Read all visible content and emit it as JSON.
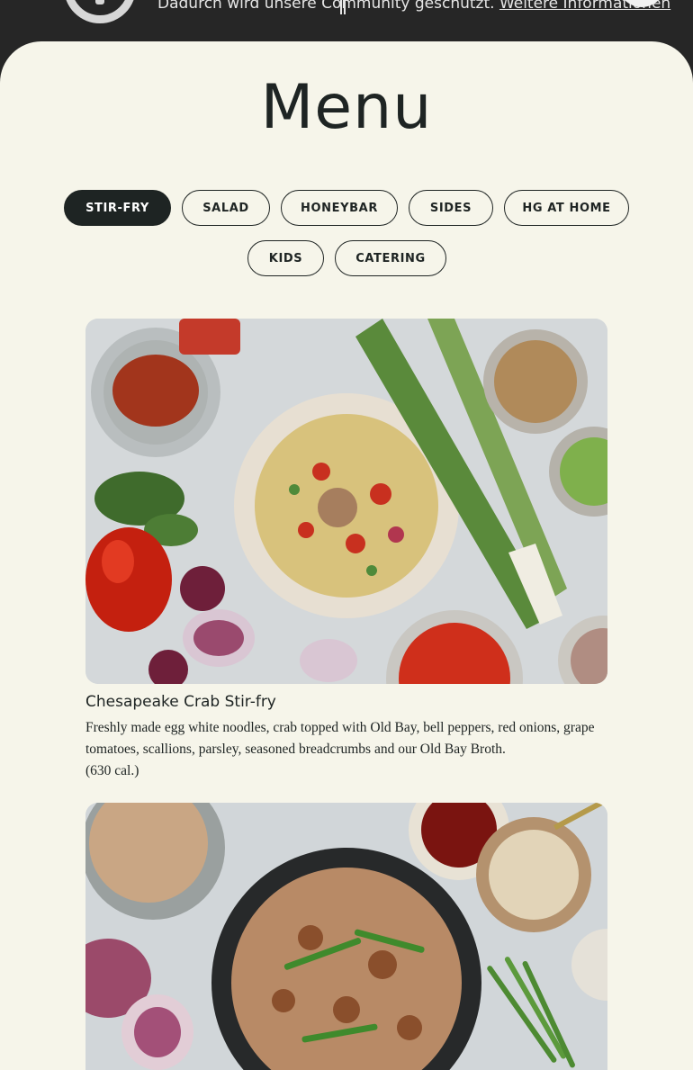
{
  "notice": {
    "text": "Dadurch wird unsere Community geschützt.",
    "link": "Weitere Informationen"
  },
  "menu": {
    "title": "Menu",
    "tabs": [
      {
        "label": "STIR-FRY",
        "active": true
      },
      {
        "label": "SALAD",
        "active": false
      },
      {
        "label": "HONEYBAR",
        "active": false
      },
      {
        "label": "SIDES",
        "active": false
      },
      {
        "label": "HG AT HOME",
        "active": false
      },
      {
        "label": "KIDS",
        "active": false
      },
      {
        "label": "CATERING",
        "active": false
      }
    ]
  },
  "items": [
    {
      "name": "Chesapeake Crab Stir-fry",
      "description": "Freshly made egg white noodles, crab topped with Old Bay, bell peppers, red onions, grape tomatoes, scallions, parsley, seasoned breadcrumbs and our Old Bay Broth.",
      "calories": "(630 cal.)"
    }
  ],
  "colors": {
    "background": "#f6f5ea",
    "dark": "#1e2423",
    "bar": "#262626"
  }
}
